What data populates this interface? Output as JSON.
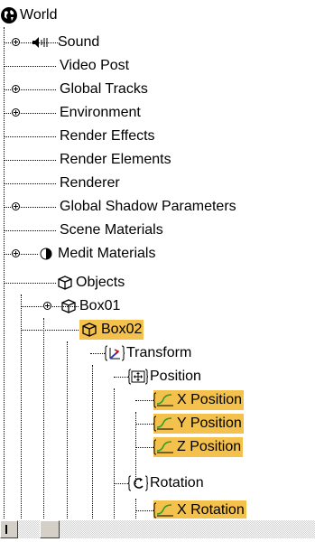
{
  "tree": {
    "world": "World",
    "sound": "Sound",
    "video_post": "Video Post",
    "global_tracks": "Global Tracks",
    "environment": "Environment",
    "render_effects": "Render Effects",
    "render_elements": "Render Elements",
    "renderer": "Renderer",
    "global_shadow_parameters": "Global Shadow Parameters",
    "scene_materials": "Scene Materials",
    "medit_materials": "Medit Materials",
    "objects": "Objects",
    "box01": "Box01",
    "box02": "Box02",
    "transform": "Transform",
    "position": "Position",
    "x_position": "X Position",
    "y_position": "Y Position",
    "z_position": "Z Position",
    "rotation": "Rotation",
    "x_rotation": "X Rotation"
  },
  "colors": {
    "highlight": "#f3c14c",
    "scrollbar": "#d4d0c8"
  },
  "icons": [
    "globe-icon",
    "speaker-icon",
    "expand-icon",
    "half-circle-icon",
    "cube-icon",
    "transform-icon",
    "position-icon",
    "curve-icon",
    "rotation-icon"
  ]
}
